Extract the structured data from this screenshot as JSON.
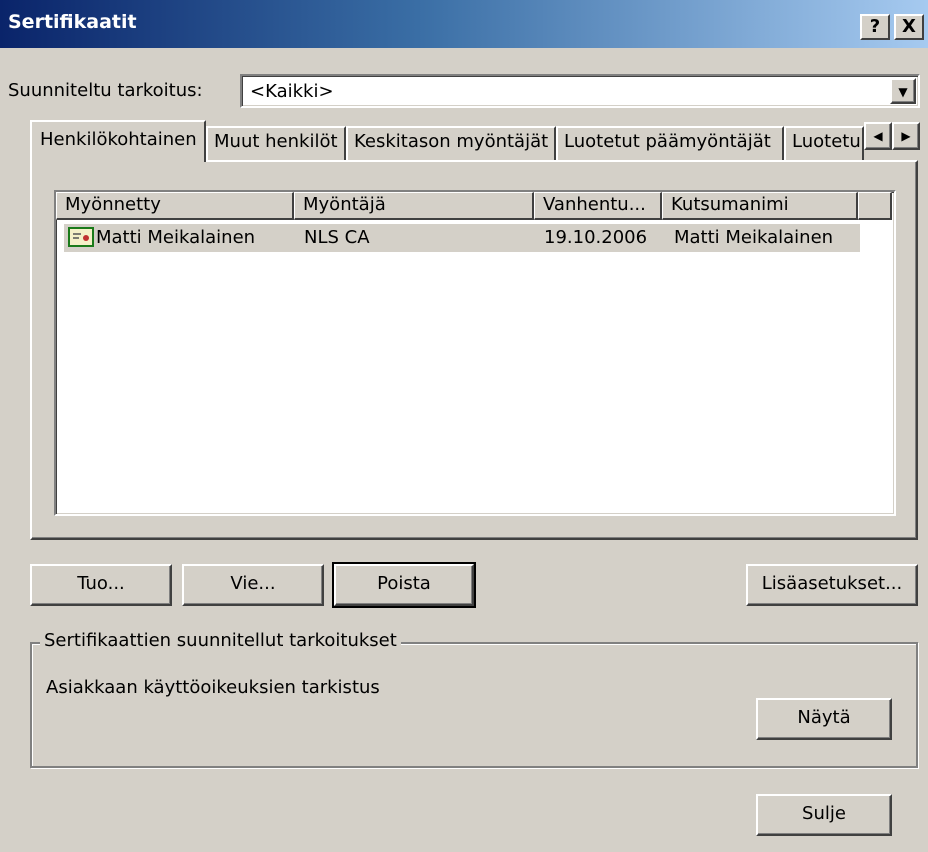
{
  "window": {
    "title": "Sertifikaatit",
    "help_button": "?",
    "close_button": "X"
  },
  "purpose": {
    "label": "Suunniteltu tarkoitus:",
    "selected": "<Kaikki>"
  },
  "tabs": [
    {
      "label": "Henkilökohtainen",
      "active": true
    },
    {
      "label": "Muut henkilöt",
      "active": false
    },
    {
      "label": "Keskitason myöntäjät",
      "active": false
    },
    {
      "label": "Luotetut päämyöntäjät",
      "active": false
    },
    {
      "label": "Luotetu",
      "active": false
    }
  ],
  "tab_scroll": {
    "left": "◀",
    "right": "▶"
  },
  "list": {
    "columns": [
      "Myönnetty",
      "Myöntäjä",
      "Vanhentu...",
      "Kutsumanimi"
    ],
    "rows": [
      {
        "icon": "certificate-icon",
        "issued_to": "Matti Meikalainen",
        "issuer": "NLS CA",
        "expires": "19.10.2006",
        "friendly_name": "Matti Meikalainen"
      }
    ]
  },
  "buttons": {
    "import": "Tuo...",
    "export": "Vie...",
    "remove": "Poista",
    "advanced": "Lisäasetukset...",
    "view": "Näytä",
    "close": "Sulje"
  },
  "purposes_group": {
    "title": "Sertifikaattien suunnitellut tarkoitukset",
    "text": "Asiakkaan käyttöoikeuksien tarkistus"
  },
  "colors": {
    "titlebar_start": "#0a246a",
    "titlebar_end": "#a6caf0",
    "face": "#d4d0c8",
    "selection": "#d4d0c8"
  }
}
